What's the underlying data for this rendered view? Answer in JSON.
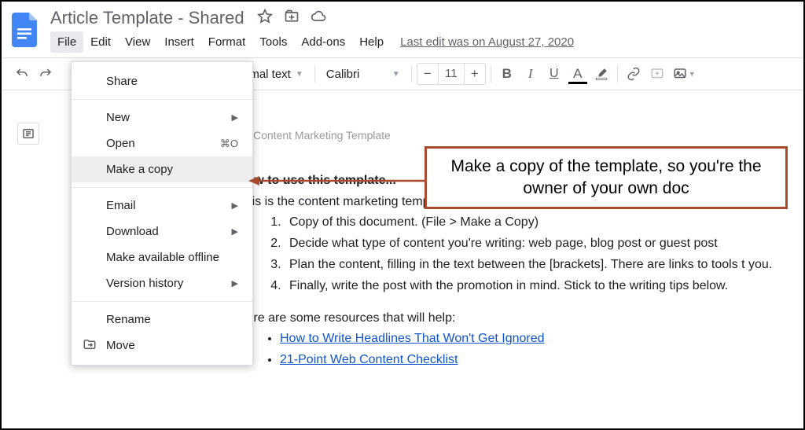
{
  "doc": {
    "title": "Article Template - Shared",
    "last_edit": "Last edit was on August 27, 2020"
  },
  "menubar": [
    "File",
    "Edit",
    "View",
    "Insert",
    "Format",
    "Tools",
    "Add-ons",
    "Help"
  ],
  "toolbar": {
    "style_name": "ormal text",
    "font_name": "Calibri",
    "font_size": "11"
  },
  "file_menu": {
    "share": "Share",
    "new": "New",
    "open": "Open",
    "open_shortcut": "⌘O",
    "make_copy": "Make a copy",
    "email": "Email",
    "download": "Download",
    "offline": "Make available offline",
    "version": "Version history",
    "rename": "Rename",
    "move": "Move"
  },
  "content": {
    "prelim": "Content Marketing Template",
    "heading": "How to use this template...",
    "intro": "This is the content marketing template we use at Orbit. We're happy to share it with you. H use it:",
    "steps": [
      "Copy of this document. (File > Make a Copy)",
      "Decide what type of content you're writing: web page, blog post or  guest post",
      "Plan the content, filling in the text between the [brackets]. There are links to tools t you.",
      "Finally, write the post with the promotion in mind. Stick to the writing tips below."
    ],
    "resources_intro": "Here are some resources that will help:",
    "links": [
      "How to Write Headlines That Won't Get Ignored",
      "21-Point Web Content Checklist"
    ]
  },
  "callout": {
    "text": "Make a copy of the template, so you're the owner of your own doc"
  }
}
